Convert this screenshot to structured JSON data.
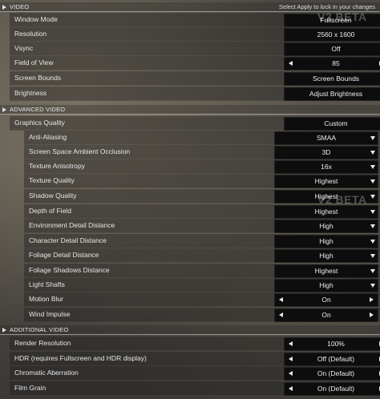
{
  "sections": {
    "video": {
      "title": "VIDEO",
      "note": "Select Apply to lock in your changes"
    },
    "advanced": {
      "title": "ADVANCED VIDEO"
    },
    "additional": {
      "title": "ADDITIONAL VIDEO"
    }
  },
  "watermark": "V2 BETA",
  "video_rows": [
    {
      "label": "Window Mode",
      "value": "Fullscreen",
      "control": "dropdown"
    },
    {
      "label": "Resolution",
      "value": "2560 x 1600",
      "control": "dropdown"
    },
    {
      "label": "Vsync",
      "value": "Off",
      "control": "dropdown"
    },
    {
      "label": "Field of View",
      "value": "85",
      "control": "stepper"
    },
    {
      "label": "Screen Bounds",
      "value": "Screen Bounds",
      "control": "button"
    },
    {
      "label": "Brightness",
      "value": "Adjust Brightness",
      "control": "button"
    }
  ],
  "advanced_rows": [
    {
      "label": "Graphics Quality",
      "value": "Custom",
      "control": "dropdown"
    },
    {
      "label": "Anti-Aliasing",
      "value": "SMAA",
      "control": "dropdown"
    },
    {
      "label": "Screen Space Ambient Occlusion",
      "value": "3D",
      "control": "dropdown"
    },
    {
      "label": "Texture Anisotropy",
      "value": "16x",
      "control": "dropdown"
    },
    {
      "label": "Texture Quality",
      "value": "Highest",
      "control": "dropdown"
    },
    {
      "label": "Shadow Quality",
      "value": "Highest",
      "control": "dropdown"
    },
    {
      "label": "Depth of Field",
      "value": "Highest",
      "control": "dropdown"
    },
    {
      "label": "Environment Detail Distance",
      "value": "High",
      "control": "dropdown"
    },
    {
      "label": "Character Detail Distance",
      "value": "High",
      "control": "dropdown"
    },
    {
      "label": "Foliage Detail Distance",
      "value": "High",
      "control": "dropdown"
    },
    {
      "label": "Foliage Shadows Distance",
      "value": "Highest",
      "control": "dropdown"
    },
    {
      "label": "Light Shafts",
      "value": "High",
      "control": "dropdown"
    },
    {
      "label": "Motion Blur",
      "value": "On",
      "control": "stepper"
    },
    {
      "label": "Wind Impulse",
      "value": "On",
      "control": "stepper"
    }
  ],
  "additional_rows": [
    {
      "label": "Render Resolution",
      "value": "100%",
      "control": "stepper"
    },
    {
      "label": "HDR (requires Fullscreen and HDR display)",
      "value": "Off (Default)",
      "control": "stepper"
    },
    {
      "label": "Chromatic Aberration",
      "value": "On (Default)",
      "control": "stepper"
    },
    {
      "label": "Film Grain",
      "value": "On (Default)",
      "control": "stepper"
    }
  ]
}
